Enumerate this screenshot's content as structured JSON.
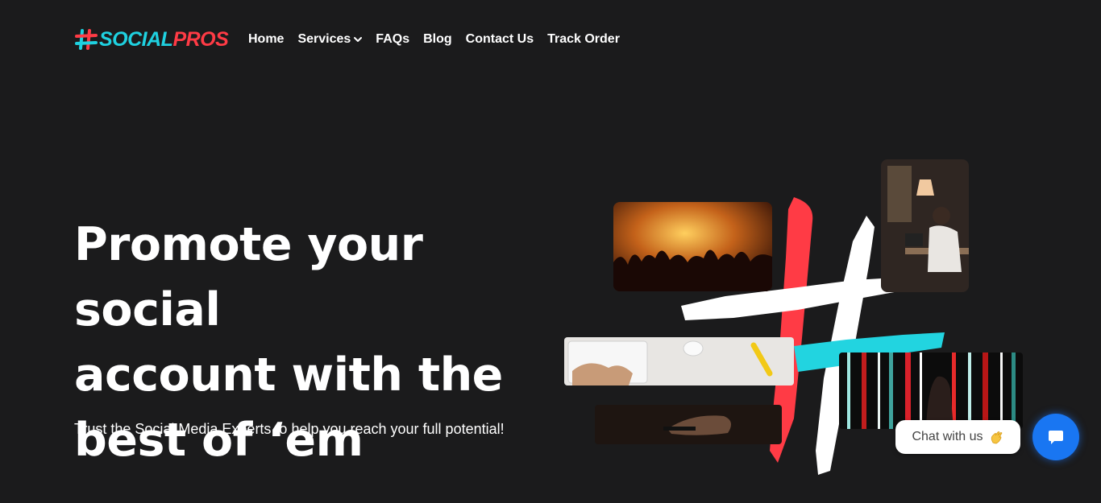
{
  "brand": {
    "name_part1": "SOCIAL",
    "name_part2": "PROS",
    "logo_icon": "hashtag-icon"
  },
  "nav": {
    "items": [
      {
        "label": "Home"
      },
      {
        "label": "Services",
        "icon": "chevron-down-icon"
      },
      {
        "label": "FAQs"
      },
      {
        "label": "Blog"
      },
      {
        "label": "Contact Us"
      },
      {
        "label": "Track Order"
      }
    ]
  },
  "hero": {
    "title_line1": "Promote your social",
    "title_line2": "account with the",
    "title_line3": "best of ‘em",
    "subtitle": "Trust the Social Media Experts to help you reach your full potential!"
  },
  "collage": {
    "images": [
      "concert-crowd-photo",
      "man-at-desk-photo",
      "keyboard-hands-photo",
      "phone-hands-photo",
      "light-stripes-photo"
    ],
    "hashtag_colors": [
      "#ff3b45",
      "#ffffff",
      "#22d4e0"
    ]
  },
  "chat": {
    "bubble_label": "Chat with us",
    "bubble_icon": "waving-hand-icon",
    "button_icon": "chat-icon"
  },
  "colors": {
    "background": "#1b1b1c",
    "brand_cyan": "#1fd1e0",
    "brand_red": "#ff3b45",
    "chat_blue": "#1976f2"
  }
}
